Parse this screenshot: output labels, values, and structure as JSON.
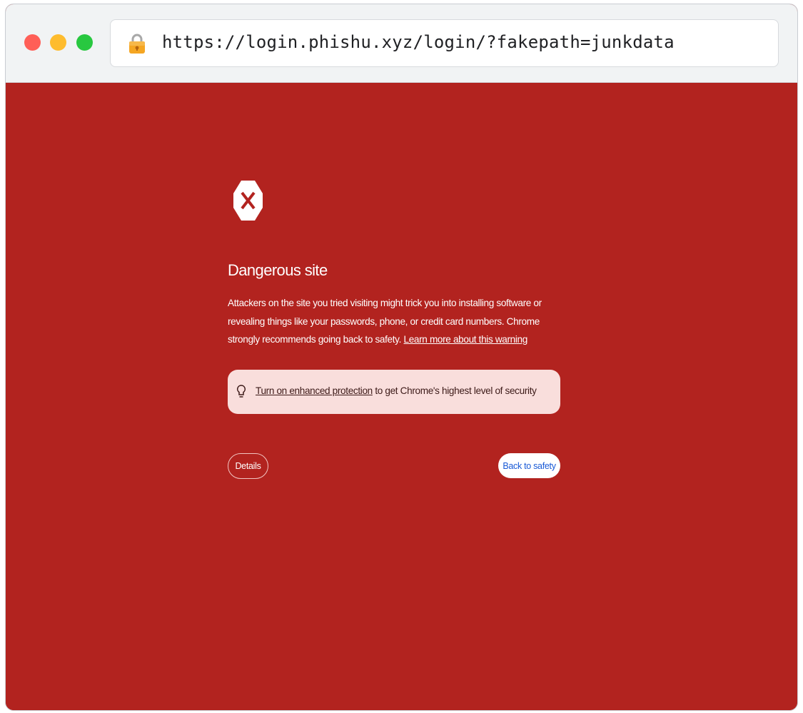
{
  "browser": {
    "url": "https://login.phishu.xyz/login/?fakepath=junkdata",
    "lock_icon": "lock-icon",
    "traffic_lights": {
      "close": "#ff5f57",
      "minimize": "#febc2e",
      "maximize": "#28c840"
    }
  },
  "warning": {
    "icon": "danger-octagon-icon",
    "title": "Dangerous site",
    "body": "Attackers on the site you tried visiting might trick you into installing software or revealing things like your passwords, phone, or credit card numbers. Chrome strongly recommends going back to safety.",
    "learn_more_link": "Learn more about this warning",
    "protection": {
      "icon": "lightbulb-icon",
      "link": "Turn on enhanced protection",
      "suffix": "to get Chrome's highest level of security"
    },
    "details_button": "Details",
    "back_button": "Back to safety"
  },
  "colors": {
    "background": "#b2231f",
    "protection_box": "#f9dedc",
    "back_button_text": "#1a5ad6"
  }
}
